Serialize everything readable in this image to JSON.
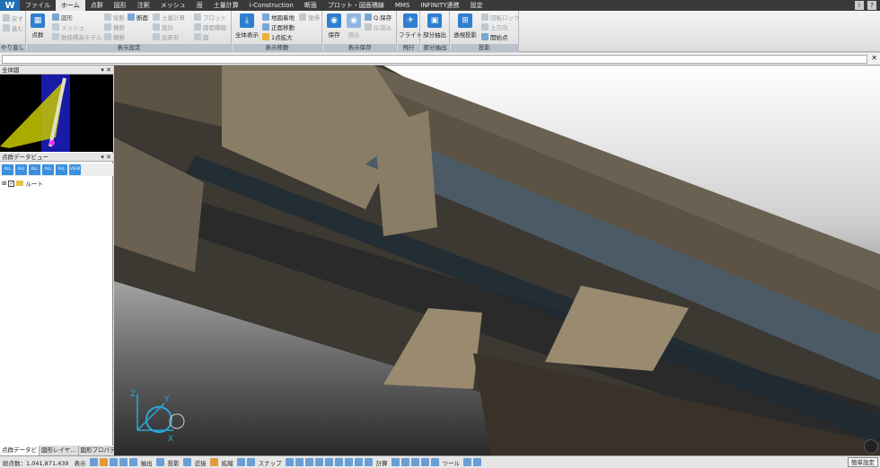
{
  "menu": {
    "tabs": [
      "ファイル",
      "ホーム",
      "点群",
      "図形",
      "注釈",
      "メッシュ",
      "面",
      "土量計算",
      "i-Construction",
      "断面",
      "プロット・図面積線",
      "MMS",
      "INFINITY連携",
      "設定"
    ],
    "active_tab": "ホーム"
  },
  "ribbon": {
    "undo": {
      "undo_label": "戻す",
      "redo_label": "進む",
      "caption": "やり直し"
    },
    "display_settings": {
      "pointcloud_label": "点群",
      "items_col1": [
        "図形",
        "メッシュ",
        "数値標高モデル"
      ],
      "items_col2": [
        "縦断",
        "横断",
        "横断"
      ],
      "items_col2b": [
        "断面"
      ],
      "items_col3": [
        "土量計算",
        "設計",
        "出来形"
      ],
      "items_col4": [
        "プロット",
        "図面積線",
        "図"
      ],
      "caption": "表示設定"
    },
    "view_move": {
      "fullview_label": "全体表示",
      "items": [
        "地図着地",
        "正面移動",
        "1点拡大"
      ],
      "reset_label": "復帰",
      "caption": "表示移動"
    },
    "view_save": {
      "save_label": "保存",
      "load_label": "読込",
      "qsave_label": "Q.保存",
      "qload_label": "Q.読込",
      "caption": "表示保存"
    },
    "survey": {
      "flight_label": "フライト",
      "caption": "飛行"
    },
    "extract": {
      "partial_label": "部分抽出",
      "caption": "部分抽出"
    },
    "projection": {
      "persp_label": "透視投影",
      "items": [
        "回転ロック",
        "上方向",
        "開始点"
      ],
      "caption": "投影"
    }
  },
  "left_panel": {
    "overview_title": "全体図",
    "data_view_title": "点群データビュー",
    "toolbar_icons": [
      "ALL",
      "ALL",
      "ALL",
      "ALL",
      "ALL",
      "VIEW"
    ],
    "tree_root": "ルート",
    "tabs": [
      "点群データビ",
      "図形レイヤ...",
      "図形プロパテ..."
    ]
  },
  "statusbar": {
    "total_points": "総点数：1,041,871,439",
    "display": "表示",
    "extract": "抽出",
    "projection": "投影",
    "nearby": "近接",
    "extend": "拡縮",
    "snap": "スナップ",
    "calc": "計算",
    "tool": "ツール",
    "simple_settings": "簡単設定"
  },
  "axis": {
    "x": "X",
    "y": "Y",
    "z": "Z"
  },
  "colors": {
    "accent": "#2f7fd0",
    "menubar": "#3a3a3a"
  }
}
